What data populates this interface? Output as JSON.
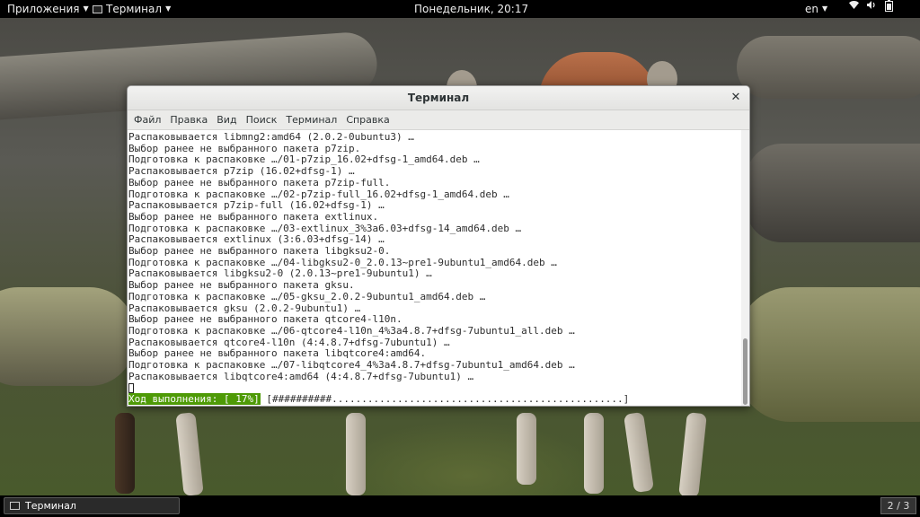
{
  "topbar": {
    "applications_label": "Приложения",
    "active_app_label": "Терминал",
    "clock": "Понедельник, 20:17",
    "language": "en"
  },
  "window": {
    "title": "Терминал",
    "menu": [
      "Файл",
      "Правка",
      "Вид",
      "Поиск",
      "Терминал",
      "Справка"
    ]
  },
  "terminal": {
    "lines": [
      "Распаковывается libmng2:amd64 (2.0.2-0ubuntu3) …",
      "Выбор ранее не выбранного пакета p7zip.",
      "Подготовка к распаковке …/01-p7zip_16.02+dfsg-1_amd64.deb …",
      "Распаковывается p7zip (16.02+dfsg-1) …",
      "Выбор ранее не выбранного пакета p7zip-full.",
      "Подготовка к распаковке …/02-p7zip-full_16.02+dfsg-1_amd64.deb …",
      "Распаковывается p7zip-full (16.02+dfsg-1) …",
      "Выбор ранее не выбранного пакета extlinux.",
      "Подготовка к распаковке …/03-extlinux_3%3a6.03+dfsg-14_amd64.deb …",
      "Распаковывается extlinux (3:6.03+dfsg-14) …",
      "Выбор ранее не выбранного пакета libgksu2-0.",
      "Подготовка к распаковке …/04-libgksu2-0_2.0.13~pre1-9ubuntu1_amd64.deb …",
      "Распаковывается libgksu2-0 (2.0.13~pre1-9ubuntu1) …",
      "Выбор ранее не выбранного пакета gksu.",
      "Подготовка к распаковке …/05-gksu_2.0.2-9ubuntu1_amd64.deb …",
      "Распаковывается gksu (2.0.2-9ubuntu1) …",
      "Выбор ранее не выбранного пакета qtcore4-l10n.",
      "Подготовка к распаковке …/06-qtcore4-l10n_4%3a4.8.7+dfsg-7ubuntu1_all.deb …",
      "Распаковывается qtcore4-l10n (4:4.8.7+dfsg-7ubuntu1) …",
      "Выбор ранее не выбранного пакета libqtcore4:amd64.",
      "Подготовка к распаковке …/07-libqtcore4_4%3a4.8.7+dfsg-7ubuntu1_amd64.deb …",
      "Распаковывается libqtcore4:amd64 (4:4.8.7+dfsg-7ubuntu1) …"
    ],
    "progress_label": "Ход выполнения: [ 17%]",
    "progress_bar": " [##########.................................................]",
    "progress_fraction": 0.17
  },
  "taskbar": {
    "window_label": "Терминал",
    "workspace": "2 / 3"
  },
  "icons": {
    "wifi": "wifi-icon",
    "volume": "volume-icon",
    "battery": "battery-icon",
    "close": "close-icon"
  }
}
